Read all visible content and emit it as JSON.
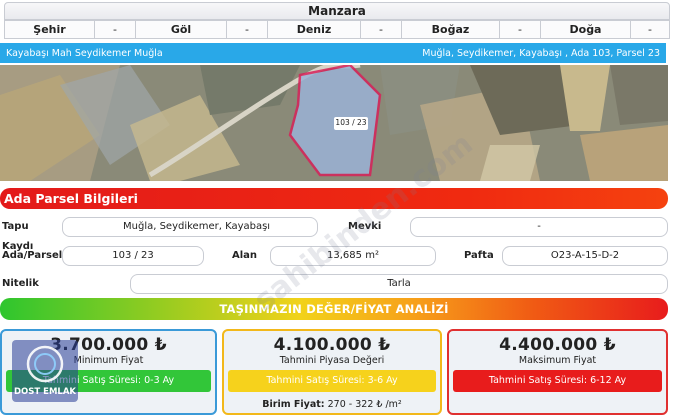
{
  "manzara": {
    "title": "Manzara",
    "items": [
      {
        "label": "Şehir",
        "value": "-"
      },
      {
        "label": "Göl",
        "value": "-"
      },
      {
        "label": "Deniz",
        "value": "-"
      },
      {
        "label": "Boğaz",
        "value": "-"
      },
      {
        "label": "Doğa",
        "value": "-"
      }
    ]
  },
  "address": {
    "left": "Kayabaşı Mah Seydikemer Muğla",
    "right": "Muğla, Seydikemer, Kayabaşı , Ada 103, Parsel 23"
  },
  "map": {
    "parcel_label": "103 / 23"
  },
  "ada_parsel": {
    "title": "Ada Parsel Bilgileri",
    "tapu_label": "Tapu Kaydı",
    "tapu_value": "Muğla, Seydikemer, Kayabaşı",
    "mevki_label": "Mevki",
    "mevki_value": "-",
    "ada_label": "Ada/Parsel",
    "ada_value": "103 / 23",
    "alan_label": "Alan",
    "alan_value": "13,685 m²",
    "pafta_label": "Pafta",
    "pafta_value": "O23-A-15-D-2",
    "nitelik_label": "Nitelik",
    "nitelik_value": "Tarla"
  },
  "analysis": {
    "title": "TAŞINMAZIN DEĞER/FİYAT ANALİZİ",
    "cards": [
      {
        "price": "3.700.000 ₺",
        "label": "Minimum Fiyat",
        "duration": "Tahmini Satış Süresi: 0-3 Ay",
        "border": "#3a9ad8",
        "bar": "#32c639"
      },
      {
        "price": "4.100.000 ₺",
        "label": "Tahmini Piyasa Değeri",
        "duration": "Tahmini Satış Süresi: 3-6 Ay",
        "border": "#f2b81a",
        "bar": "#f6d21c"
      },
      {
        "price": "4.400.000 ₺",
        "label": "Maksimum Fiyat",
        "duration": "Tahmini Satış Süresi: 6-12 Ay",
        "border": "#e03030",
        "bar": "#e81c1c"
      }
    ],
    "unit_price_label": "Birim Fiyat:",
    "unit_price_value": "270 - 322 ₺ /m²"
  },
  "logo": {
    "text": "DOST EMLAK"
  },
  "watermark": "sahibinden.com"
}
